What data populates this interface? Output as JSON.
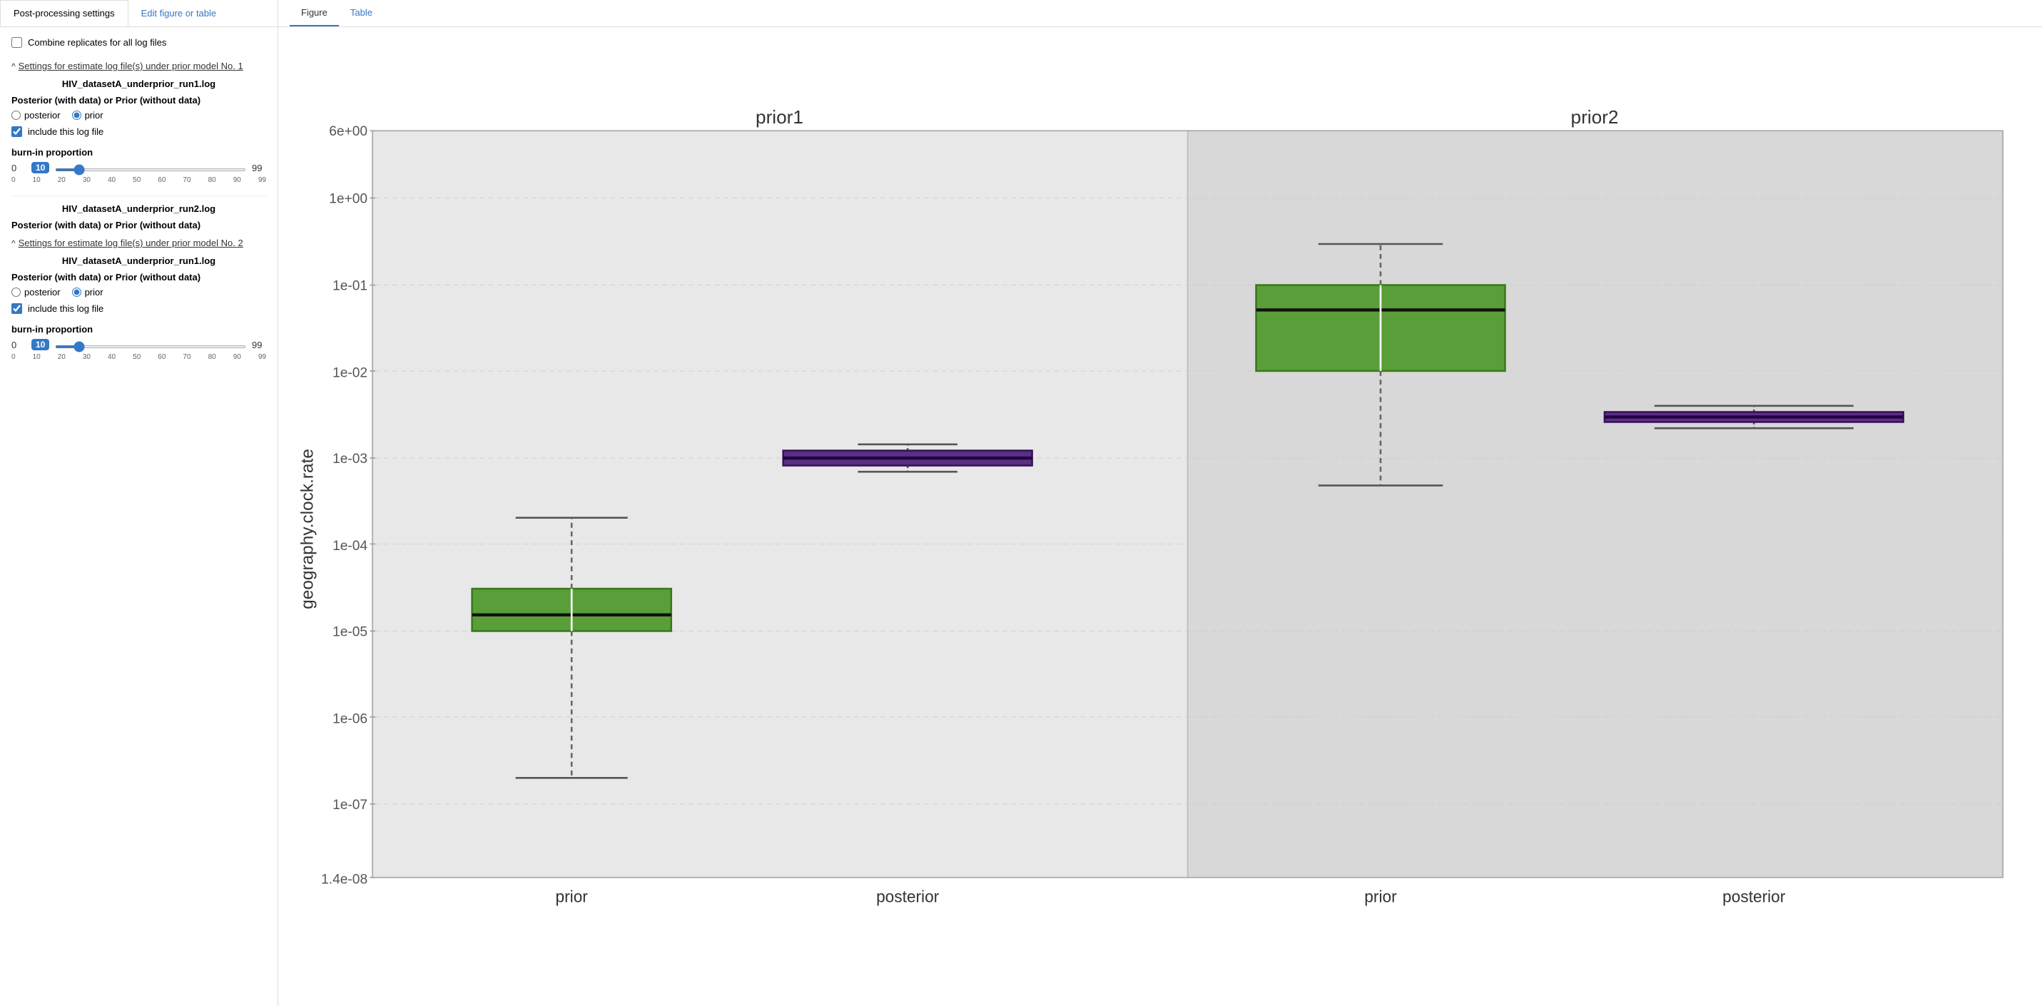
{
  "leftPanel": {
    "tabs": [
      {
        "id": "post-processing",
        "label": "Post-processing settings",
        "active": true
      },
      {
        "id": "edit-figure",
        "label": "Edit figure or table",
        "active": false
      }
    ],
    "combineReplicates": {
      "label": "Combine replicates for all log files",
      "checked": false
    },
    "prior1": {
      "sectionHeader": "Settings for estimate log file(s) under prior model No. 1",
      "caretSymbol": "^",
      "runs": [
        {
          "id": "run1",
          "fileName": "HIV_datasetA_underprior_run1.log",
          "posteriorPriorLabel": "Posterior (with data) or Prior (without data)",
          "posteriorChecked": false,
          "priorChecked": true,
          "includeLabel": "include this log file",
          "includeChecked": true,
          "burnInLabel": "burn-in proportion",
          "burnInMin": 0,
          "burnInMax": 99,
          "burnInValue": 10,
          "sliderTicks": [
            "0",
            "10",
            "20",
            "30",
            "40",
            "50",
            "60",
            "70",
            "80",
            "90",
            "99"
          ]
        }
      ]
    },
    "run2Section": {
      "fileName": "HIV_datasetA_underprior_run2.log",
      "posteriorPriorLabel": "Posterior (with data) or Prior (without data)"
    },
    "prior2": {
      "sectionHeader": "Settings for estimate log file(s) under prior model No. 2",
      "caretSymbol": "^",
      "runs": [
        {
          "id": "run1",
          "fileName": "HIV_datasetA_underprior_run1.log",
          "posteriorPriorLabel": "Posterior (with data) or Prior (without data)",
          "posteriorChecked": false,
          "priorChecked": true,
          "includeLabel": "include this log file",
          "includeChecked": true,
          "burnInLabel": "burn-in proportion",
          "burnInMin": 0,
          "burnInMax": 99,
          "burnInValue": 10,
          "sliderTicks": [
            "0",
            "10",
            "20",
            "30",
            "40",
            "50",
            "60",
            "70",
            "80",
            "90",
            "99"
          ]
        }
      ]
    }
  },
  "rightPanel": {
    "tabs": [
      {
        "id": "figure",
        "label": "Figure",
        "active": true
      },
      {
        "id": "table",
        "label": "Table",
        "active": false
      }
    ],
    "chart": {
      "yAxisLabel": "geography.clock.rate",
      "yAxisTicks": [
        "6e+00",
        "1e+00",
        "1e-01",
        "1e-02",
        "1e-03",
        "1e-04",
        "1e-05",
        "1e-06",
        "1e-07",
        "1.4e-08"
      ],
      "prior1Label": "prior1",
      "prior2Label": "prior2",
      "xLabels": [
        "prior",
        "posterior",
        "prior",
        "posterior"
      ]
    }
  }
}
